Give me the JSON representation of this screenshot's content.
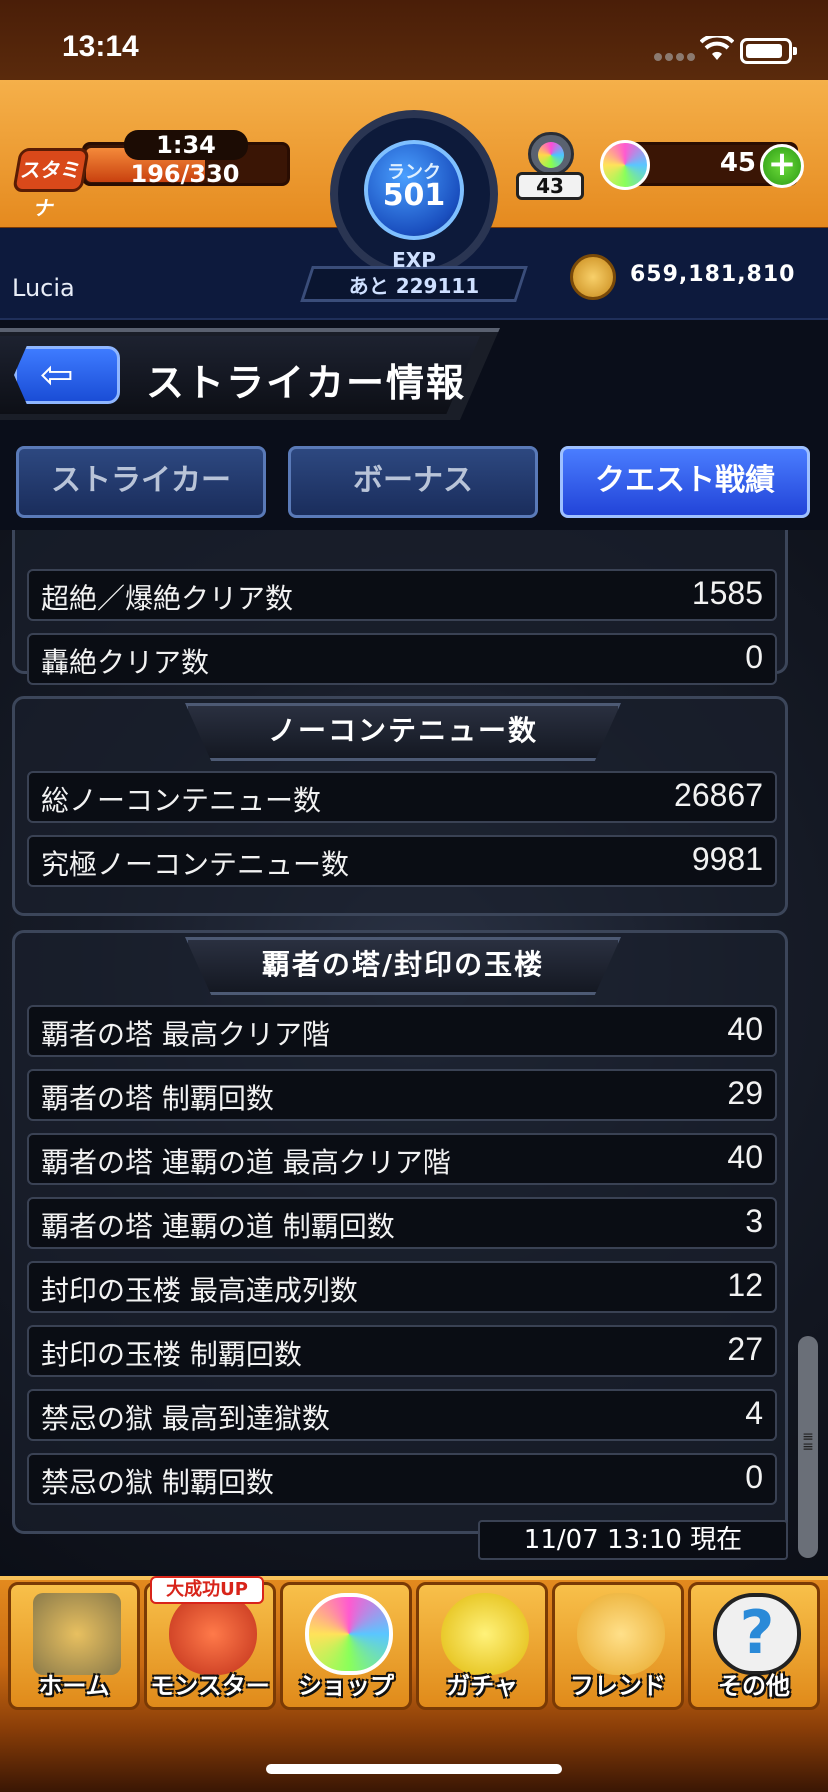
{
  "status_bar": {
    "time": "13:14"
  },
  "header": {
    "stamina_label": "スタミナ",
    "stamina_timer": "1:34",
    "stamina_value": "196/330",
    "stamina_fraction": 0.594,
    "rank_label": "ランク",
    "rank_value": "501",
    "exp_label": "EXP",
    "exp_remaining": "あと 229111",
    "orb_counter": "43",
    "orb_value": "45",
    "plus_label": "+",
    "coin_value": "659,181,810",
    "user_name": "Lucia"
  },
  "title_bar": {
    "title": "ストライカー情報",
    "back_glyph": "⇦"
  },
  "tabs": [
    {
      "label": "ストライカー",
      "active": false
    },
    {
      "label": "ボーナス",
      "active": false
    },
    {
      "label": "クエスト戦績",
      "active": true
    }
  ],
  "sections": {
    "top": {
      "rows": [
        {
          "label": "超絶／爆絶クリア数",
          "value": "1585"
        },
        {
          "label": "轟絶クリア数",
          "value": "0"
        }
      ]
    },
    "no_continue": {
      "title": "ノーコンテニュー数",
      "rows": [
        {
          "label": "総ノーコンテニュー数",
          "value": "26867"
        },
        {
          "label": "究極ノーコンテニュー数",
          "value": "9981"
        }
      ]
    },
    "tower": {
      "title": "覇者の塔/封印の玉楼",
      "rows": [
        {
          "label": "覇者の塔 最高クリア階",
          "value": "40"
        },
        {
          "label": "覇者の塔 制覇回数",
          "value": "29"
        },
        {
          "label": "覇者の塔 連覇の道 最高クリア階",
          "value": "40"
        },
        {
          "label": "覇者の塔 連覇の道 制覇回数",
          "value": "3"
        },
        {
          "label": "封印の玉楼 最高達成列数",
          "value": "12"
        },
        {
          "label": "封印の玉楼 制覇回数",
          "value": "27"
        },
        {
          "label": "禁忌の獄 最高到達獄数",
          "value": "4"
        },
        {
          "label": "禁忌の獄 制覇回数",
          "value": "0"
        }
      ]
    }
  },
  "timestamp": "11/07 13:10 現在",
  "bottom_nav": {
    "badge": "大成功UP",
    "items": [
      {
        "label": "ホーム",
        "icon": "home-icon",
        "color": "#8a7a4a"
      },
      {
        "label": "モンスター",
        "icon": "monster-icon",
        "color": "#d8452a"
      },
      {
        "label": "ショップ",
        "icon": "orb-icon",
        "color": "#7a5aff"
      },
      {
        "label": "ガチャ",
        "icon": "gacha-egg-icon",
        "color": "#f2d21a"
      },
      {
        "label": "フレンド",
        "icon": "friend-icon",
        "color": "#f6c23a"
      },
      {
        "label": "その他",
        "icon": "question-icon",
        "color": "#4a4a4a"
      }
    ]
  }
}
